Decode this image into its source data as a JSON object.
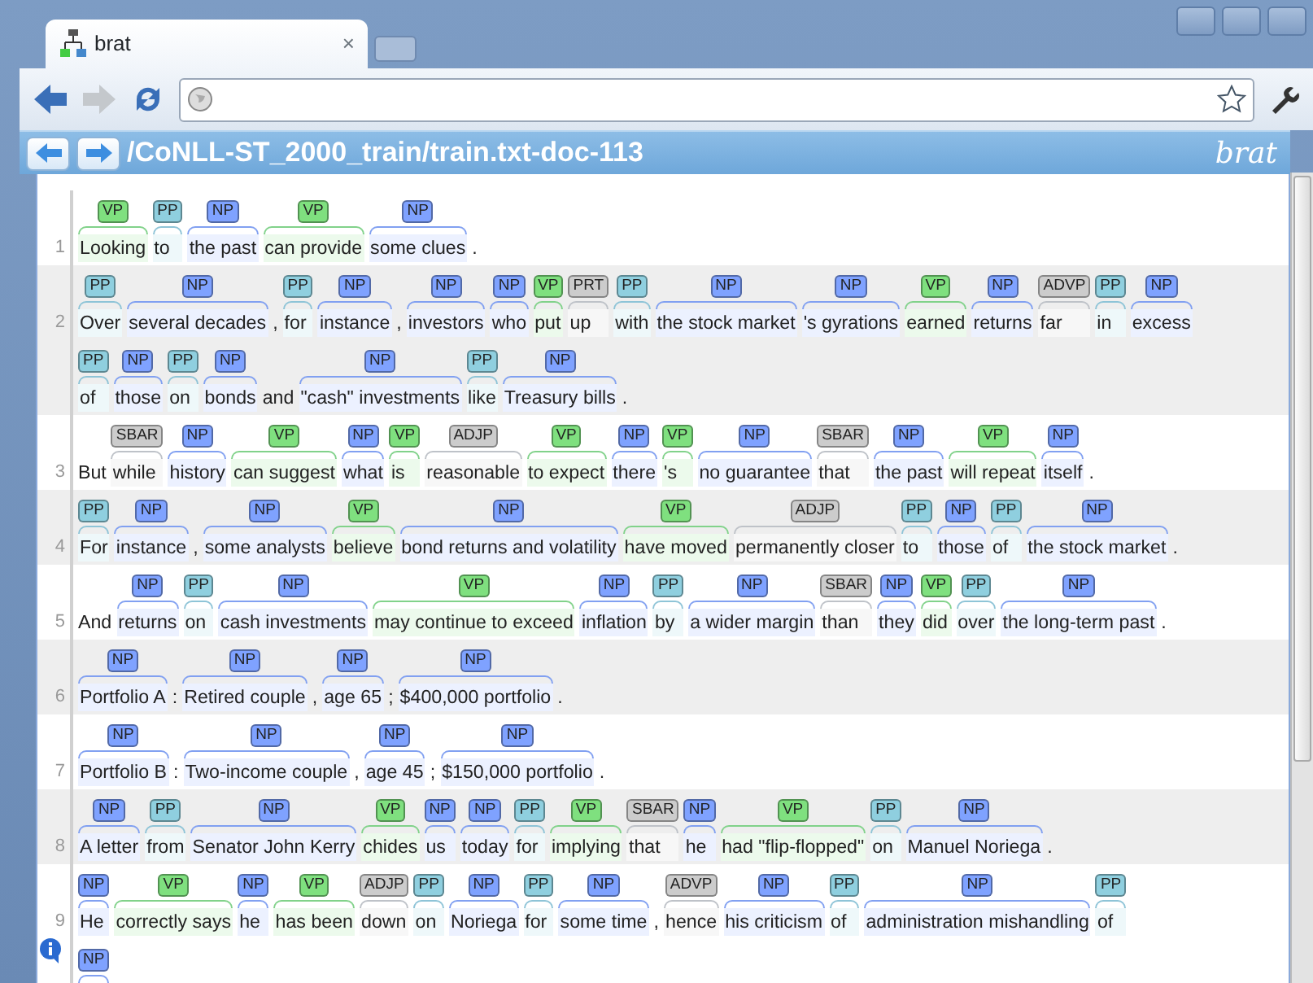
{
  "browser": {
    "tab_title": "brat",
    "tab_close": "×"
  },
  "brat_bar": {
    "path": "/CoNLL-ST_2000_train/train.txt-doc-113",
    "logo": "brat"
  },
  "sentences": [
    {
      "number": "1",
      "lines": [
        [
          {
            "label": "VP",
            "text": "Looking",
            "color": "#7fe07f"
          },
          {
            "label": "PP",
            "text": "to",
            "color": "#8fcfdf"
          },
          {
            "label": "NP",
            "text": "the past",
            "color": "#7fa2ff"
          },
          {
            "label": "VP",
            "text": "can provide",
            "color": "#7fe07f"
          },
          {
            "label": "NP",
            "text": "some clues",
            "color": "#7fa2ff"
          },
          {
            "text": "."
          }
        ]
      ]
    },
    {
      "number": "2",
      "lines": [
        [
          {
            "label": "PP",
            "text": "Over",
            "color": "#8fcfdf"
          },
          {
            "label": "NP",
            "text": "several decades",
            "color": "#7fa2ff"
          },
          {
            "text": ", "
          },
          {
            "label": "PP",
            "text": "for",
            "color": "#8fcfdf"
          },
          {
            "label": "NP",
            "text": "instance",
            "color": "#7fa2ff"
          },
          {
            "text": ","
          },
          {
            "label": "NP",
            "text": "investors",
            "color": "#7fa2ff"
          },
          {
            "label": "NP",
            "text": "who",
            "color": "#7fa2ff"
          },
          {
            "label": "VP",
            "text": "put",
            "color": "#7fe07f"
          },
          {
            "label": "PRT",
            "text": "up",
            "color": "#cccccc"
          },
          {
            "label": "PP",
            "text": "with",
            "color": "#8fcfdf"
          },
          {
            "label": "NP",
            "text": "the stock market",
            "color": "#7fa2ff"
          },
          {
            "label": "NP",
            "text": "'s gyrations",
            "color": "#7fa2ff"
          },
          {
            "label": "VP",
            "text": "earned",
            "color": "#7fe07f"
          },
          {
            "label": "NP",
            "text": "returns",
            "color": "#7fa2ff"
          },
          {
            "label": "ADVP",
            "text": "far",
            "color": "#cccccc"
          },
          {
            "label": "PP",
            "text": "in",
            "color": "#8fcfdf"
          },
          {
            "label": "NP",
            "text": "excess",
            "color": "#7fa2ff"
          }
        ],
        [
          {
            "label": "PP",
            "text": "of",
            "color": "#8fcfdf"
          },
          {
            "label": "NP",
            "text": "those",
            "color": "#7fa2ff"
          },
          {
            "label": "PP",
            "text": "on",
            "color": "#8fcfdf"
          },
          {
            "label": "NP",
            "text": "bonds",
            "color": "#7fa2ff"
          },
          {
            "text": "and"
          },
          {
            "label": "NP",
            "text": "\"cash\" investments",
            "color": "#7fa2ff"
          },
          {
            "label": "PP",
            "text": "like",
            "color": "#8fcfdf"
          },
          {
            "label": "NP",
            "text": "Treasury bills",
            "color": "#7fa2ff"
          },
          {
            "text": "."
          }
        ]
      ]
    },
    {
      "number": "3",
      "lines": [
        [
          {
            "text": "But"
          },
          {
            "label": "SBAR",
            "text": "while",
            "color": "#cccccc"
          },
          {
            "label": "NP",
            "text": "history",
            "color": "#7fa2ff"
          },
          {
            "label": "VP",
            "text": "can suggest",
            "color": "#7fe07f"
          },
          {
            "label": "NP",
            "text": "what",
            "color": "#7fa2ff"
          },
          {
            "label": "VP",
            "text": "is",
            "color": "#7fe07f"
          },
          {
            "label": "ADJP",
            "text": "reasonable",
            "color": "#cccccc"
          },
          {
            "label": "VP",
            "text": "to expect",
            "color": "#7fe07f"
          },
          {
            "label": "NP",
            "text": "there",
            "color": "#7fa2ff"
          },
          {
            "label": "VP",
            "text": "'s",
            "color": "#7fe07f"
          },
          {
            "label": "NP",
            "text": "no guarantee",
            "color": "#7fa2ff"
          },
          {
            "label": "SBAR",
            "text": "that",
            "color": "#cccccc"
          },
          {
            "label": "NP",
            "text": "the past",
            "color": "#7fa2ff"
          },
          {
            "label": "VP",
            "text": "will repeat",
            "color": "#7fe07f"
          },
          {
            "label": "NP",
            "text": "itself",
            "color": "#7fa2ff"
          },
          {
            "text": "."
          }
        ]
      ]
    },
    {
      "number": "4",
      "lines": [
        [
          {
            "label": "PP",
            "text": "For",
            "color": "#8fcfdf"
          },
          {
            "label": "NP",
            "text": "instance",
            "color": "#7fa2ff"
          },
          {
            "text": ","
          },
          {
            "label": "NP",
            "text": "some analysts",
            "color": "#7fa2ff"
          },
          {
            "label": "VP",
            "text": "believe",
            "color": "#7fe07f"
          },
          {
            "label": "NP",
            "text": "bond returns and volatility",
            "color": "#7fa2ff"
          },
          {
            "label": "VP",
            "text": "have moved",
            "color": "#7fe07f"
          },
          {
            "label": "ADJP",
            "text": "permanently closer",
            "color": "#cccccc"
          },
          {
            "label": "PP",
            "text": "to",
            "color": "#8fcfdf"
          },
          {
            "label": "NP",
            "text": "those",
            "color": "#7fa2ff"
          },
          {
            "label": "PP",
            "text": "of",
            "color": "#8fcfdf"
          },
          {
            "label": "NP",
            "text": "the stock market",
            "color": "#7fa2ff"
          },
          {
            "text": "."
          }
        ]
      ]
    },
    {
      "number": "5",
      "lines": [
        [
          {
            "text": "And"
          },
          {
            "label": "NP",
            "text": "returns",
            "color": "#7fa2ff"
          },
          {
            "label": "PP",
            "text": "on",
            "color": "#8fcfdf"
          },
          {
            "label": "NP",
            "text": "cash investments",
            "color": "#7fa2ff"
          },
          {
            "label": "VP",
            "text": "may continue to exceed",
            "color": "#7fe07f"
          },
          {
            "label": "NP",
            "text": "inflation",
            "color": "#7fa2ff"
          },
          {
            "label": "PP",
            "text": "by",
            "color": "#8fcfdf"
          },
          {
            "label": "NP",
            "text": "a wider margin",
            "color": "#7fa2ff"
          },
          {
            "label": "SBAR",
            "text": "than",
            "color": "#cccccc"
          },
          {
            "label": "NP",
            "text": "they",
            "color": "#7fa2ff"
          },
          {
            "label": "VP",
            "text": "did",
            "color": "#7fe07f"
          },
          {
            "label": "PP",
            "text": "over",
            "color": "#8fcfdf"
          },
          {
            "label": "NP",
            "text": "the long-term past",
            "color": "#7fa2ff"
          },
          {
            "text": "."
          }
        ]
      ]
    },
    {
      "number": "6",
      "lines": [
        [
          {
            "label": "NP",
            "text": "Portfolio A",
            "color": "#7fa2ff"
          },
          {
            "text": ":"
          },
          {
            "label": "NP",
            "text": "Retired couple",
            "color": "#7fa2ff"
          },
          {
            "text": ","
          },
          {
            "label": "NP",
            "text": "age 65",
            "color": "#7fa2ff"
          },
          {
            "text": ";"
          },
          {
            "label": "NP",
            "text": "$400,000 portfolio",
            "color": "#7fa2ff"
          },
          {
            "text": "."
          }
        ]
      ]
    },
    {
      "number": "7",
      "lines": [
        [
          {
            "label": "NP",
            "text": "Portfolio B",
            "color": "#7fa2ff"
          },
          {
            "text": ":"
          },
          {
            "label": "NP",
            "text": "Two-income couple",
            "color": "#7fa2ff"
          },
          {
            "text": ","
          },
          {
            "label": "NP",
            "text": "age 45",
            "color": "#7fa2ff"
          },
          {
            "text": ";"
          },
          {
            "label": "NP",
            "text": "$150,000 portfolio",
            "color": "#7fa2ff"
          },
          {
            "text": "."
          }
        ]
      ]
    },
    {
      "number": "8",
      "lines": [
        [
          {
            "label": "NP",
            "text": "A letter",
            "color": "#7fa2ff"
          },
          {
            "label": "PP",
            "text": "from",
            "color": "#8fcfdf"
          },
          {
            "label": "NP",
            "text": "Senator John Kerry",
            "color": "#7fa2ff"
          },
          {
            "label": "VP",
            "text": "chides",
            "color": "#7fe07f"
          },
          {
            "label": "NP",
            "text": "us",
            "color": "#7fa2ff"
          },
          {
            "label": "NP",
            "text": "today",
            "color": "#7fa2ff"
          },
          {
            "label": "PP",
            "text": "for",
            "color": "#8fcfdf"
          },
          {
            "label": "VP",
            "text": "implying",
            "color": "#7fe07f"
          },
          {
            "label": "SBAR",
            "text": "that",
            "color": "#cccccc"
          },
          {
            "label": "NP",
            "text": "he",
            "color": "#7fa2ff"
          },
          {
            "label": "VP",
            "text": "had \"flip-flopped\"",
            "color": "#7fe07f"
          },
          {
            "label": "PP",
            "text": "on",
            "color": "#8fcfdf"
          },
          {
            "label": "NP",
            "text": "Manuel Noriega",
            "color": "#7fa2ff"
          },
          {
            "text": "."
          }
        ]
      ]
    },
    {
      "number": "9",
      "lines": [
        [
          {
            "label": "NP",
            "text": "He",
            "color": "#7fa2ff"
          },
          {
            "label": "VP",
            "text": "correctly says",
            "color": "#7fe07f"
          },
          {
            "label": "NP",
            "text": "he",
            "color": "#7fa2ff"
          },
          {
            "label": "VP",
            "text": "has been",
            "color": "#7fe07f"
          },
          {
            "label": "ADJP",
            "text": "down",
            "color": "#cccccc"
          },
          {
            "label": "PP",
            "text": "on",
            "color": "#8fcfdf"
          },
          {
            "label": "NP",
            "text": "Noriega",
            "color": "#7fa2ff"
          },
          {
            "label": "PP",
            "text": "for",
            "color": "#8fcfdf"
          },
          {
            "label": "NP",
            "text": "some time",
            "color": "#7fa2ff"
          },
          {
            "text": ","
          },
          {
            "label": "ADVP",
            "text": "hence",
            "color": "#cccccc"
          },
          {
            "label": "NP",
            "text": "his criticism",
            "color": "#7fa2ff"
          },
          {
            "label": "PP",
            "text": "of",
            "color": "#8fcfdf"
          },
          {
            "label": "NP",
            "text": "administration mishandling",
            "color": "#7fa2ff"
          },
          {
            "label": "PP",
            "text": "of",
            "color": "#8fcfdf"
          }
        ],
        [
          {
            "label": "NP",
            "color": "#7fa2ff"
          }
        ]
      ]
    }
  ]
}
